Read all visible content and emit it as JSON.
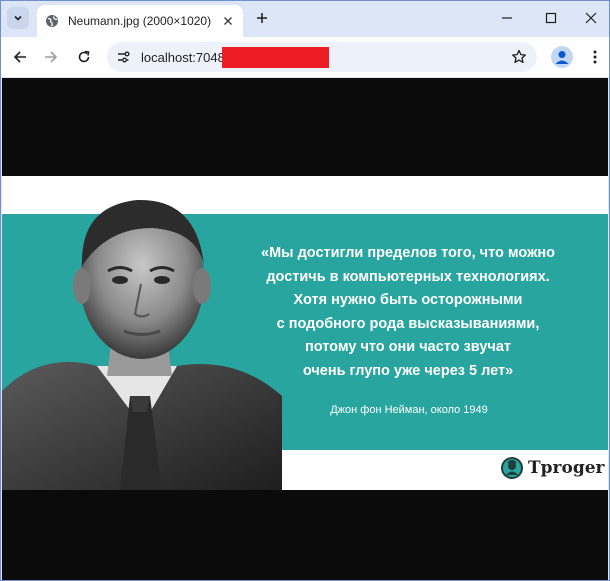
{
  "tab": {
    "title": "Neumann.jpg (2000×1020)",
    "favicon": "globe-icon"
  },
  "toolbar": {
    "url_visible": "localhost:7048/",
    "url_redacted": true
  },
  "colors": {
    "tab_strip": "#dde6f6",
    "omnibox": "#edf2fa",
    "image_band": "#29a59f",
    "redaction": "#ee1c25",
    "viewport_bg": "#0b0b0b"
  },
  "image": {
    "quote_lines": [
      "«Мы достигли пределов того, что можно",
      "достичь в компьютерных технологиях.",
      "Хотя нужно быть осторожными",
      "с подобного рода высказываниями,",
      "потому что они часто звучат",
      "очень глупо уже через 5 лет»"
    ],
    "attribution": "Джон фон Нейман, около 1949",
    "logo_text": "Tproger"
  }
}
